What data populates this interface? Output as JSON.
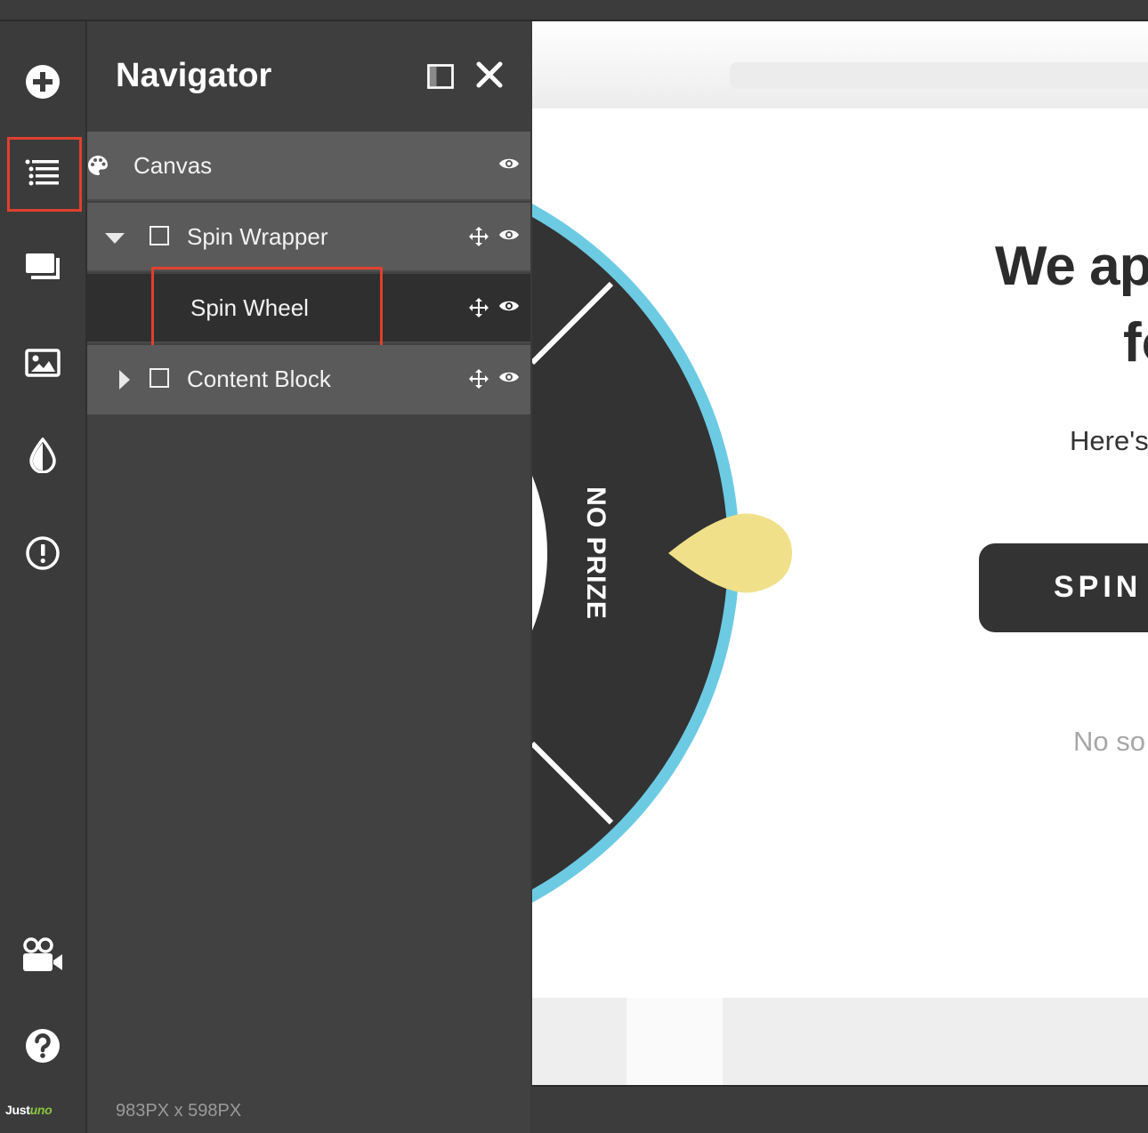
{
  "brand": {
    "name_part1": "Just",
    "name_part2": "uno"
  },
  "rail": {
    "icons": [
      "add-icon",
      "list-icon",
      "layers-icon",
      "image-icon",
      "color-drop-icon",
      "alert-icon",
      "video-camera-icon",
      "help-icon"
    ],
    "selected": "list-icon"
  },
  "navigator": {
    "title": "Navigator",
    "tree": [
      {
        "label": "Canvas",
        "level": 0,
        "icon": "palette-icon"
      },
      {
        "label": "Spin Wrapper",
        "level": 1,
        "expanded": true
      },
      {
        "label": "Spin Wheel",
        "level": 2,
        "selected": true
      },
      {
        "label": "Content Block",
        "level": 1,
        "expanded": false
      }
    ],
    "dimensions": "983PX x 598PX"
  },
  "preview": {
    "wheel_segment_label": "NO PRIZE",
    "headline_line1": "We ap",
    "headline_line2": "fo",
    "subtext": "Here's",
    "spin_button": "SPIN",
    "decline_text": "No so"
  },
  "colors": {
    "accent_highlight": "#e0402e",
    "wheel_ring": "#6ccbe3",
    "wheel_segment": "#333333",
    "pointer": "#f0e08a",
    "brand_green": "#8cc63f"
  }
}
